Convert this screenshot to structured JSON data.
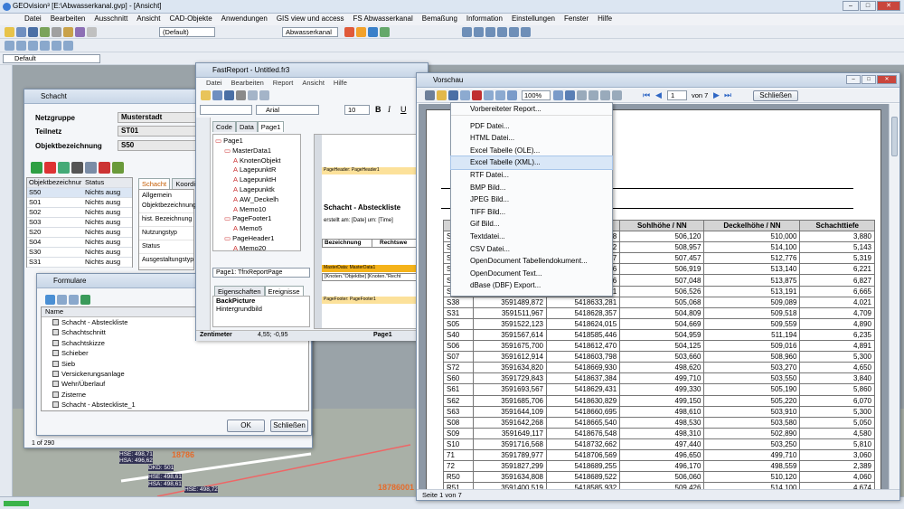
{
  "app": {
    "title": "GEOvision³ [E:\\Abwasserkanal.gvp] - [Ansicht]",
    "menu": [
      "Datei",
      "Bearbeiten",
      "Ausschnitt",
      "Ansicht",
      "CAD-Objekte",
      "Anwendungen",
      "GIS view und access",
      "FS Abwasserkanal",
      "Bemaßung",
      "Information",
      "Einstellungen",
      "Fenster",
      "Hilfe"
    ],
    "toolbar": {
      "scale": "(Default)",
      "layer": "Abwasserkanal",
      "style": "Default"
    }
  },
  "schacht": {
    "title": "Schacht",
    "netzgruppe_label": "Netzgruppe",
    "netzgruppe": "Musterstadt",
    "teilnetz_label": "Teilnetz",
    "teilnetz": "ST01",
    "objekt_label": "Objektbezeichnung",
    "objekt": "S50",
    "grid_cols": [
      "Objektbezeichnur",
      "Status"
    ],
    "rows": [
      {
        "id": "S50",
        "status": "Nichts ausg"
      },
      {
        "id": "S01",
        "status": "Nichts ausg"
      },
      {
        "id": "S02",
        "status": "Nichts ausg"
      },
      {
        "id": "S03",
        "status": "Nichts ausg"
      },
      {
        "id": "S20",
        "status": "Nichts ausg"
      },
      {
        "id": "S04",
        "status": "Nichts ausg"
      },
      {
        "id": "S30",
        "status": "Nichts ausg"
      },
      {
        "id": "S31",
        "status": "Nichts ausg"
      }
    ],
    "tabs": [
      "Schacht",
      "Koordinat"
    ],
    "group": "Allgemein",
    "props": [
      "Objektbezeichnung",
      "hist. Bezeichnung",
      "Nutzungstyp",
      "Status",
      "Ausgestaltungstyp"
    ],
    "record": "1 of 290"
  },
  "formulare": {
    "title": "Formulare",
    "col_name": "Name",
    "items": [
      "Schacht - Absteckliste",
      "Schachtschnitt",
      "Schachtskizze",
      "Schieber",
      "Sieb",
      "Versickerungsanlage",
      "Wehr/Überlauf",
      "Zisterne",
      "Schacht - Absteckliste_1"
    ],
    "ok": "OK",
    "close": "Schließen"
  },
  "fastreport": {
    "title": "FastReport - Untitled.fr3",
    "menu": [
      "Datei",
      "Bearbeiten",
      "Report",
      "Ansicht",
      "Hilfe"
    ],
    "font": "Arial",
    "size": "10",
    "tabs": [
      "Code",
      "Data",
      "Page1"
    ],
    "tree": [
      "Page1",
      "MasterData1",
      "KnotenObjekt",
      "LagepunktR",
      "LagepunktH",
      "Lagepunktk",
      "AW_Deckelh",
      "Memo10",
      "PageFooter1",
      "Memo5",
      "PageHeader1",
      "Memo20"
    ],
    "page_select": "Page1: TfrxReportPage",
    "ptabs": [
      "Eigenschaften",
      "Ereignisse"
    ],
    "prop_name": "BackPicture",
    "prop_value": "Hintergrundbild",
    "band_header": "PageHeader: PageHeader1",
    "band_title": "Schacht - Absteckliste",
    "band_created": "erstellt am: [Date] um: [Time]",
    "col_bez": "Bezeichnung",
    "col_rw": "Rechtswe",
    "band_master": "MasterData: MasterData1",
    "band_master_fields": "[Knoten.\"Objektbe] [Knoten.\"Recht",
    "band_footer": "PageFooter: PageFooter1",
    "status_unit": "Zentimeter",
    "status_coords": "4,55; -0,95",
    "status_page": "Page1"
  },
  "vorschau": {
    "title": "Vorschau",
    "zoom": "100%",
    "page": "1",
    "of": "von 7",
    "close": "Schließen",
    "status": "Seite 1 von 7",
    "headers": [
      "B",
      "R",
      "Hochwert",
      "Sohlhöhe / NN",
      "Deckelhöhe / NN",
      "Schachttiefe"
    ],
    "rows": [
      [
        "S",
        "",
        "5418591,838",
        "506,120",
        "510,000",
        "3,880"
      ],
      [
        "S",
        "",
        "5418586,262",
        "508,957",
        "514,100",
        "5,143"
      ],
      [
        "S",
        "",
        "5418592,537",
        "507,457",
        "512,776",
        "5,319"
      ],
      [
        "S",
        "",
        "5418581,316",
        "506,919",
        "513,140",
        "6,221"
      ],
      [
        "S",
        "",
        "5418560,746",
        "507,048",
        "513,875",
        "6,827"
      ],
      [
        "S",
        "",
        "5418572,861",
        "506,526",
        "513,191",
        "6,665"
      ],
      [
        "S38",
        "3591489,872",
        "5418633,281",
        "505,068",
        "509,089",
        "4,021"
      ],
      [
        "S31",
        "3591511,967",
        "5418628,357",
        "504,809",
        "509,518",
        "4,709"
      ],
      [
        "S05",
        "3591522,123",
        "5418624,015",
        "504,669",
        "509,559",
        "4,890"
      ],
      [
        "S40",
        "3591567,614",
        "5418585,446",
        "504,959",
        "511,194",
        "6,235"
      ],
      [
        "S06",
        "3591675,700",
        "5418612,470",
        "504,125",
        "509,016",
        "4,891"
      ],
      [
        "S07",
        "3591612,914",
        "5418603,798",
        "503,660",
        "508,960",
        "5,300"
      ],
      [
        "S72",
        "3591634,820",
        "5418669,930",
        "498,620",
        "503,270",
        "4,650"
      ],
      [
        "S60",
        "3591729,843",
        "5418637,384",
        "499,710",
        "503,550",
        "3,840"
      ],
      [
        "S61",
        "3591693,567",
        "5418629,431",
        "499,330",
        "505,190",
        "5,860"
      ],
      [
        "S62",
        "3591685,706",
        "5418630,829",
        "499,150",
        "505,220",
        "6,070"
      ],
      [
        "S63",
        "3591644,109",
        "5418660,695",
        "498,610",
        "503,910",
        "5,300"
      ],
      [
        "S08",
        "3591642,268",
        "5418665,540",
        "498,530",
        "503,580",
        "5,050"
      ],
      [
        "S09",
        "3591649,117",
        "5418676,548",
        "498,310",
        "502,890",
        "4,580"
      ],
      [
        "S10",
        "3591716,568",
        "5418732,662",
        "497,440",
        "503,250",
        "5,810"
      ],
      [
        "71",
        "3591789,977",
        "5418706,569",
        "496,650",
        "499,710",
        "3,060"
      ],
      [
        "72",
        "3591827,299",
        "5418689,255",
        "496,170",
        "498,559",
        "2,389"
      ],
      [
        "R50",
        "3591634,808",
        "5418689,522",
        "506,060",
        "510,120",
        "4,060"
      ],
      [
        "R51",
        "3591400,519",
        "5418585,932",
        "509,426",
        "514,100",
        "4,674"
      ]
    ],
    "export_menu": [
      "Vorbereiteter Report...",
      "PDF Datei...",
      "HTML Datei...",
      "Excel Tabelle (OLE)...",
      "Excel Tabelle (XML)...",
      "RTF Datei...",
      "BMP Bild...",
      "JPEG Bild...",
      "TIFF Bild...",
      "Gif Bild...",
      "Textdatei...",
      "CSV Datei...",
      "OpenDocument Tabellendokument...",
      "OpenDocument Text...",
      "dBase (DBF) Export..."
    ],
    "selected": "Excel Tabelle (XML)..."
  },
  "map": {
    "labels": [
      "HSE: 498,71",
      "HSA: 496,62",
      "DKD: 501",
      "HSE: 498,61",
      "HSA: 498,61",
      "HSE: 498,72",
      "18786",
      "18786001"
    ]
  }
}
